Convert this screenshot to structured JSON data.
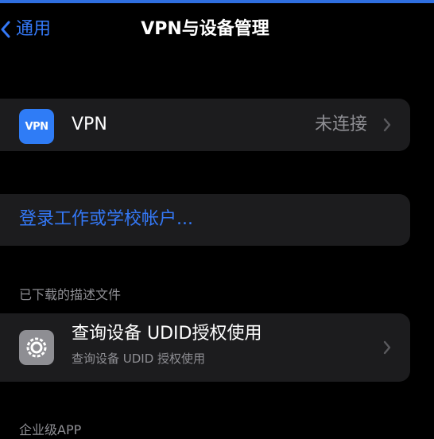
{
  "nav": {
    "back_label": "通用",
    "title": "VPN与设备管理"
  },
  "vpn_row": {
    "icon_text": "VPN",
    "label": "VPN",
    "status": "未连接"
  },
  "login_row": {
    "label": "登录工作或学校帐户..."
  },
  "sections": {
    "downloaded_header": "已下载的描述文件",
    "enterprise_header": "企业级APP"
  },
  "profile_row": {
    "title": "查询设备 UDID授权使用",
    "subtitle": "查询设备 UDID 授权使用"
  },
  "colors": {
    "accent": "#3478f6",
    "background": "#000000",
    "cell": "#1c1c1e",
    "secondary_text": "#8e8e93",
    "vpn_icon": "#2f7cf6"
  },
  "icons": {
    "back": "chevron-left-icon",
    "disclosure": "chevron-right-icon",
    "profile": "settings-gear-icon"
  }
}
